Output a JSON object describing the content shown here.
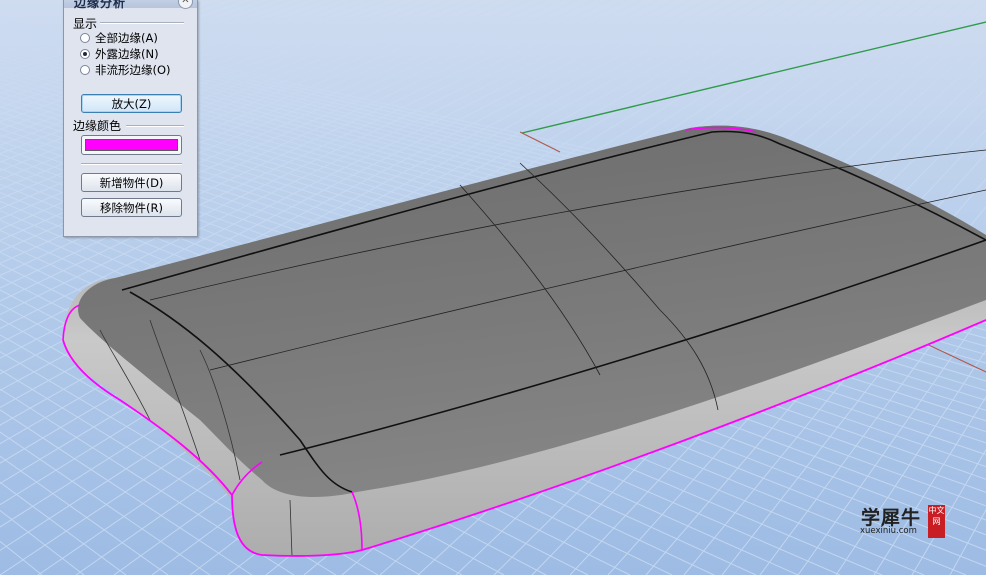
{
  "panel": {
    "title": "边缘分析",
    "close_icon": "close-icon",
    "display_label": "显示",
    "options": [
      {
        "label": "全部边缘(A)",
        "selected": false
      },
      {
        "label": "外露边缘(N)",
        "selected": true
      },
      {
        "label": "非流形边缘(O)",
        "selected": false
      }
    ],
    "zoom_button": "放大(Z)",
    "edge_color_label": "边缘颜色",
    "edge_color": "#ff00ff",
    "add_objects_button": "新增物件(D)",
    "remove_objects_button": "移除物件(R)"
  },
  "viewport": {
    "background_color": "#a9c4e8",
    "grid_color": "#c7d9f0",
    "x_axis_color": "#b05a4e",
    "y_axis_color": "#2f9a4a",
    "model_color": "#7c7c7c",
    "highlight_color": "#ff00ff"
  },
  "watermark": {
    "text": "学犀牛",
    "url": "xuexiniu.com",
    "badge": "中文网"
  }
}
